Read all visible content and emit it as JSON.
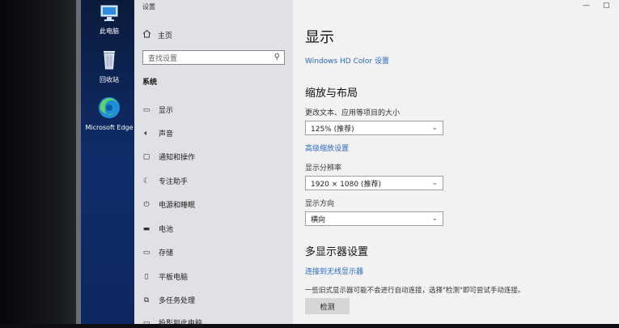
{
  "desktop_icons": [
    {
      "label": "此电脑",
      "icon": "this-pc-icon"
    },
    {
      "label": "回收站",
      "icon": "recycle-bin-icon"
    },
    {
      "label": "Microsoft Edge",
      "icon": "edge-icon"
    }
  ],
  "window": {
    "title": "设置"
  },
  "sidebar": {
    "home_label": "主页",
    "search_placeholder": "查找设置",
    "section": "系统",
    "items": [
      {
        "label": "显示",
        "icon": "display-icon"
      },
      {
        "label": "声音",
        "icon": "sound-icon"
      },
      {
        "label": "通知和操作",
        "icon": "notification-icon"
      },
      {
        "label": "专注助手",
        "icon": "focus-assist-icon"
      },
      {
        "label": "电源和睡眠",
        "icon": "power-icon"
      },
      {
        "label": "电池",
        "icon": "battery-icon"
      },
      {
        "label": "存储",
        "icon": "storage-icon"
      },
      {
        "label": "平板电脑",
        "icon": "tablet-icon"
      },
      {
        "label": "多任务处理",
        "icon": "multitasking-icon"
      },
      {
        "label": "投影到此电脑",
        "icon": "projecting-icon"
      }
    ]
  },
  "main": {
    "title": "显示",
    "hdr_link": "Windows HD Color 设置",
    "scale_section": "缩放与布局",
    "text_size_label": "更改文本、应用等项目的大小",
    "text_size_value": "125% (推荐)",
    "advanced_scaling_link": "高级缩放设置",
    "resolution_label": "显示分辨率",
    "resolution_value": "1920 × 1080 (推荐)",
    "orientation_label": "显示方向",
    "orientation_value": "横向",
    "multi_section": "多显示器设置",
    "wireless_link": "连接到无线显示器",
    "detect_desc": "一些旧式显示器可能不会进行自动连接，选择\"检测\"即可尝试手动连接。",
    "detect_button": "检测"
  },
  "colors": {
    "accent": "#2b69c4",
    "sidebar_bg": "#dfe1e4",
    "main_bg": "#f2f2f2"
  }
}
